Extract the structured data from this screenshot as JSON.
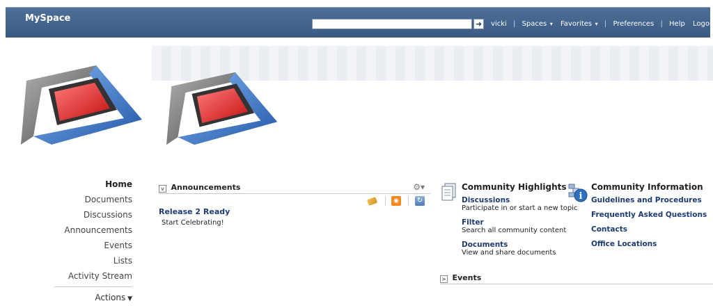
{
  "header": {
    "brand": "MySpace",
    "search": {
      "value": "",
      "placeholder": ""
    },
    "links": {
      "user": "vicki",
      "spaces": "Spaces",
      "favorites": "Favorites",
      "preferences": "Preferences",
      "help": "Help",
      "logout": "Logout"
    },
    "colors": {
      "bar": "#3f6189",
      "text": "#ffffff"
    }
  },
  "nav": {
    "items": [
      "Home",
      "Documents",
      "Discussions",
      "Announcements",
      "Events",
      "Lists",
      "Activity Stream"
    ],
    "actions": "Actions"
  },
  "announcements": {
    "title": "Announcements",
    "items": [
      {
        "title": "Release 2 Ready",
        "text": "Start Celebrating!"
      }
    ],
    "icons": [
      "tag-icon",
      "rss-icon",
      "refresh-icon",
      "gear-icon"
    ]
  },
  "highlights": {
    "title": "Community Highlights",
    "items": [
      {
        "label": "Discussions",
        "desc": "Participate in or start a new topic"
      },
      {
        "label": "Filter",
        "desc": "Search all community content"
      },
      {
        "label": "Documents",
        "desc": "View and share documents"
      }
    ]
  },
  "information": {
    "title": "Community Information",
    "items": [
      "Guidelines and Procedures",
      "Frequently Asked Questions",
      "Contacts",
      "Office Locations"
    ]
  },
  "events": {
    "title": "Events"
  },
  "accent": {
    "link": "#1c3b73",
    "logo_red": "#e23030",
    "logo_blue": "#3d7cc9",
    "logo_gray": "#6f6f6f"
  }
}
